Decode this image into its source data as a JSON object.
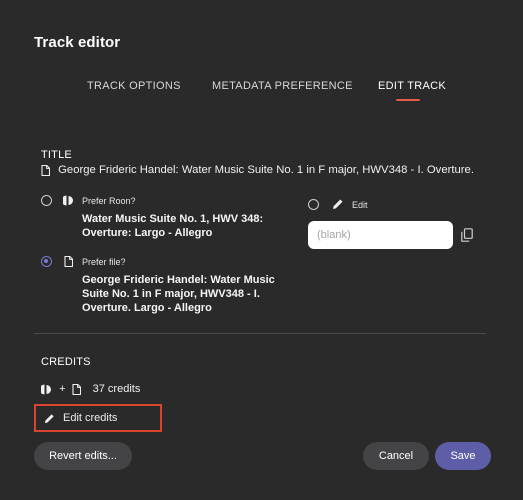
{
  "dialog": {
    "title": "Track editor"
  },
  "tabs": [
    {
      "label": "TRACK OPTIONS",
      "active": false
    },
    {
      "label": "METADATA PREFERENCE",
      "active": false
    },
    {
      "label": "EDIT TRACK",
      "active": true
    }
  ],
  "title_section": {
    "heading": "TITLE",
    "current_title": "George Frideric Handel: Water Music Suite No. 1 in F major, HWV348 - I. Overture.",
    "options": [
      {
        "label": "Prefer Roon?",
        "value": "Water Music Suite No. 1, HWV 348: Overture: Largo - Allegro",
        "selected": false,
        "icon": "roon-icon"
      },
      {
        "label": "Prefer file?",
        "value": "George Frideric Handel: Water Music Suite No. 1 in F major, HWV348 - I. Overture. Largo - Allegro",
        "selected": true,
        "icon": "file-icon"
      }
    ],
    "edit_option": {
      "label": "Edit",
      "selected": false,
      "icon": "pencil-icon"
    },
    "edit_field": {
      "value": "",
      "placeholder": "(blank)"
    }
  },
  "credits_section": {
    "heading": "CREDITS",
    "plus": "+",
    "count_text": "37 credits",
    "edit_button": "Edit credits"
  },
  "footer": {
    "revert_label": "Revert edits...",
    "cancel_label": "Cancel",
    "save_label": "Save"
  },
  "colors": {
    "background": "#2a2a2b",
    "accent_underline": "#e35b4a",
    "radio_selected": "#7a7bd0",
    "save_button": "#5e5ea8",
    "highlight_box": "#d9452d"
  }
}
